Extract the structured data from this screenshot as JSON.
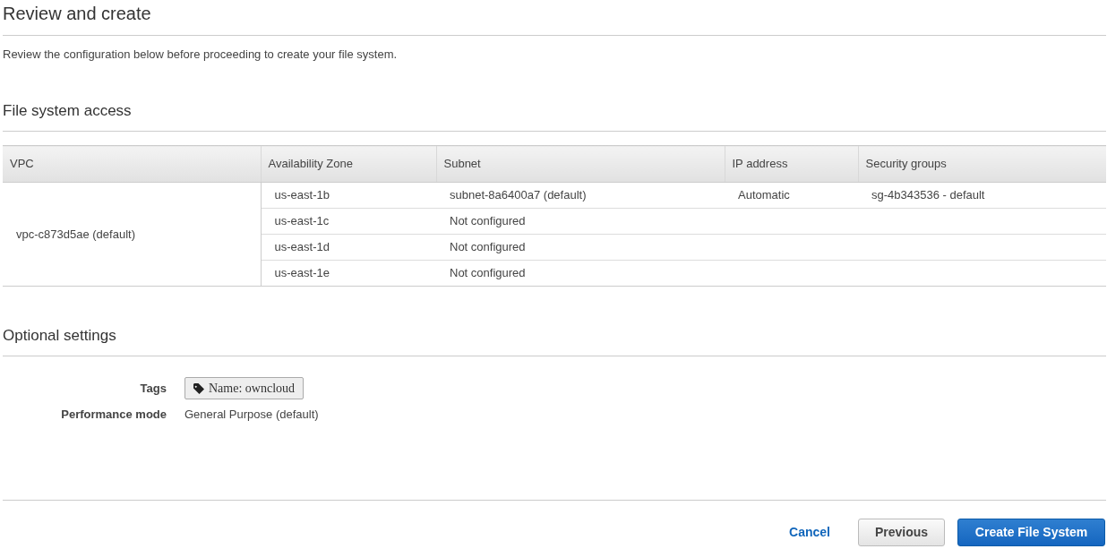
{
  "title": "Review and create",
  "description": "Review the configuration below before proceeding to create your file system.",
  "file_system_access": {
    "heading": "File system access",
    "table": {
      "columns": [
        "VPC",
        "Availability Zone",
        "Subnet",
        "IP address",
        "Security groups"
      ],
      "vpc": "vpc-c873d5ae (default)",
      "rows": [
        {
          "zone": "us-east-1b",
          "subnet": "subnet-8a6400a7 (default)",
          "ip_address": "Automatic",
          "security_groups": "sg-4b343536 - default"
        },
        {
          "zone": "us-east-1c",
          "subnet": "Not configured"
        },
        {
          "zone": "us-east-1d",
          "subnet": "Not configured"
        },
        {
          "zone": "us-east-1e",
          "subnet": "Not configured"
        }
      ]
    }
  },
  "optional_settings": {
    "heading": "Optional settings",
    "tags_label": "Tags",
    "tags": [
      "Name: owncloud"
    ],
    "performance_mode_label": "Performance mode",
    "performance_mode": "General Purpose (default)"
  },
  "buttons": {
    "cancel": "Cancel",
    "previous": "Previous",
    "create": "Create File System"
  }
}
